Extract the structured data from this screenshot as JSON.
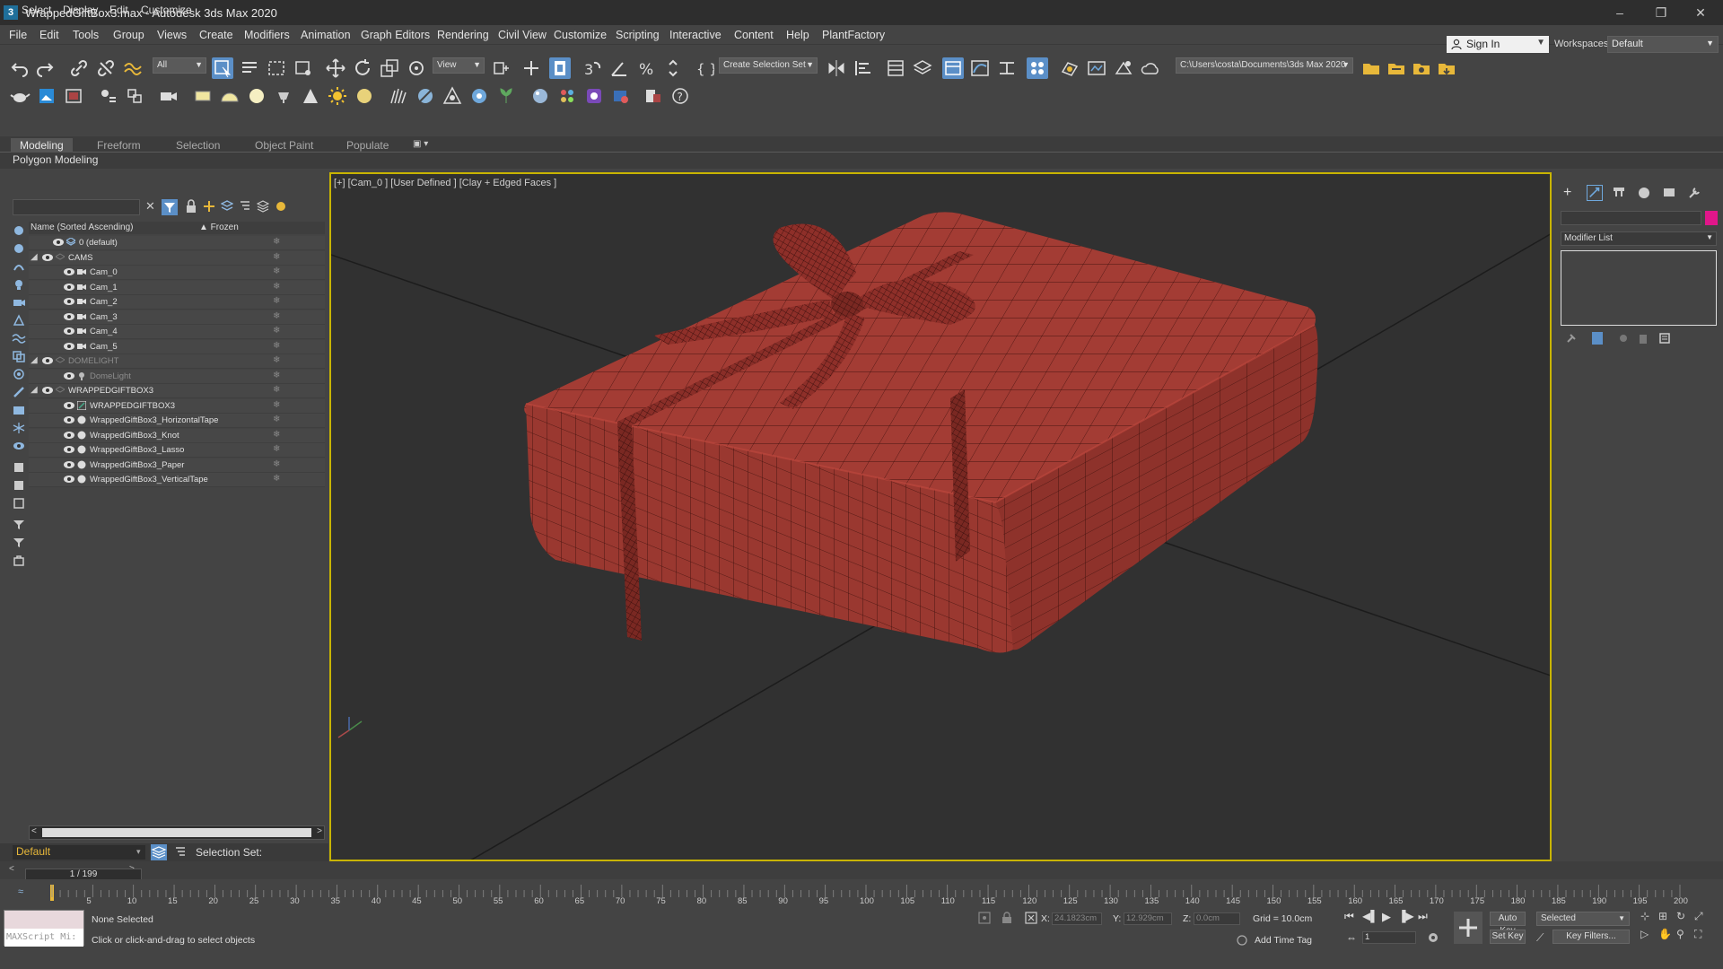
{
  "window": {
    "title": "WrappedGiftBox3.max - Autodesk 3ds Max 2020",
    "app_icon": "3",
    "minimize_glyph": "–",
    "maximize_glyph": "❐",
    "close_glyph": "✕"
  },
  "menubar": {
    "items": [
      "File",
      "Edit",
      "Tools",
      "Group",
      "Views",
      "Create",
      "Modifiers",
      "Animation",
      "Graph Editors",
      "Rendering",
      "Civil View",
      "Customize",
      "Scripting",
      "Interactive",
      "Content",
      "Help",
      "PlantFactory"
    ]
  },
  "account": {
    "signin_label": "Sign In",
    "workspaces_label": "Workspaces:",
    "workspace_value": "Default"
  },
  "toolbar": {
    "filter_value": "All",
    "refcoord_value": "View",
    "selection_set_placeholder": "Create Selection Set",
    "project_path": "C:\\Users\\costa\\Documents\\3ds Max 2020"
  },
  "ribbon": {
    "tabs": [
      "Modeling",
      "Freeform",
      "Selection",
      "Object Paint",
      "Populate"
    ],
    "active_tab": "Modeling",
    "subpanel": "Polygon Modeling"
  },
  "scene_explorer": {
    "menu": [
      "Select",
      "Display",
      "Edit",
      "Customize"
    ],
    "header_name": "Name (Sorted Ascending)",
    "header_frozen": "▲ Frozen",
    "rows": [
      {
        "label": "0 (default)",
        "indent": 1,
        "toggle": "",
        "type": "layer",
        "dim": false
      },
      {
        "label": "CAMS",
        "indent": 0,
        "toggle": "◢",
        "type": "group",
        "dim": false
      },
      {
        "label": "Cam_0",
        "indent": 2,
        "toggle": "",
        "type": "camera",
        "dim": false
      },
      {
        "label": "Cam_1",
        "indent": 2,
        "toggle": "",
        "type": "camera",
        "dim": false
      },
      {
        "label": "Cam_2",
        "indent": 2,
        "toggle": "",
        "type": "camera",
        "dim": false
      },
      {
        "label": "Cam_3",
        "indent": 2,
        "toggle": "",
        "type": "camera",
        "dim": false
      },
      {
        "label": "Cam_4",
        "indent": 2,
        "toggle": "",
        "type": "camera",
        "dim": false
      },
      {
        "label": "Cam_5",
        "indent": 2,
        "toggle": "",
        "type": "camera",
        "dim": false
      },
      {
        "label": "DOMELIGHT",
        "indent": 0,
        "toggle": "◢",
        "type": "group",
        "dim": true
      },
      {
        "label": "DomeLight",
        "indent": 2,
        "toggle": "",
        "type": "light",
        "dim": true
      },
      {
        "label": "WRAPPEDGIFTBOX3",
        "indent": 0,
        "toggle": "◢",
        "type": "group",
        "dim": false
      },
      {
        "label": "WRAPPEDGIFTBOX3",
        "indent": 2,
        "toggle": "",
        "type": "helper",
        "dim": false
      },
      {
        "label": "WrappedGiftBox3_HorizontalTape",
        "indent": 2,
        "toggle": "",
        "type": "mesh",
        "dim": false
      },
      {
        "label": "WrappedGiftBox3_Knot",
        "indent": 2,
        "toggle": "",
        "type": "mesh",
        "dim": false
      },
      {
        "label": "WrappedGiftBox3_Lasso",
        "indent": 2,
        "toggle": "",
        "type": "mesh",
        "dim": false
      },
      {
        "label": "WrappedGiftBox3_Paper",
        "indent": 2,
        "toggle": "",
        "type": "mesh",
        "dim": false
      },
      {
        "label": "WrappedGiftBox3_VerticalTape",
        "indent": 2,
        "toggle": "",
        "type": "mesh",
        "dim": false
      }
    ],
    "snowflake_glyph": "❄",
    "layer_value": "Default",
    "selection_set_label": "Selection Set:"
  },
  "viewport": {
    "label": "[+] [Cam_0 ] [User Defined ] [Clay + Edged Faces ]",
    "box_color": "#9c3a33",
    "wire_color": "#3a0f0c",
    "highlight_color": "#c8b400"
  },
  "command_panel": {
    "modifier_list": "Modifier List",
    "object_color": "#e0168a"
  },
  "timeline": {
    "frame_display": "1 / 199",
    "ticks": [
      "5",
      "10",
      "15",
      "20",
      "25",
      "30",
      "35",
      "40",
      "45",
      "50",
      "55",
      "60",
      "65",
      "70",
      "75",
      "80",
      "85",
      "90",
      "95",
      "100",
      "105",
      "110",
      "115",
      "120",
      "125",
      "130",
      "135",
      "140",
      "145",
      "150",
      "155",
      "160",
      "165",
      "170",
      "175",
      "180",
      "185",
      "190",
      "195",
      "200"
    ]
  },
  "status": {
    "maxscript_label": "MAXScript Mi:",
    "selection_status": "None Selected",
    "prompt": "Click or click-and-drag to select objects",
    "x_label": "X:",
    "x_value": "24.1823cm",
    "y_label": "Y:",
    "y_value": "12.929cm",
    "z_label": "Z:",
    "z_value": "0.0cm",
    "grid": "Grid = 10.0cm",
    "add_time_tag": "Add Time Tag",
    "auto_key": "Auto Key",
    "set_key": "Set Key",
    "key_mode": "Selected",
    "key_filters": "Key Filters...",
    "current_frame": "1"
  }
}
